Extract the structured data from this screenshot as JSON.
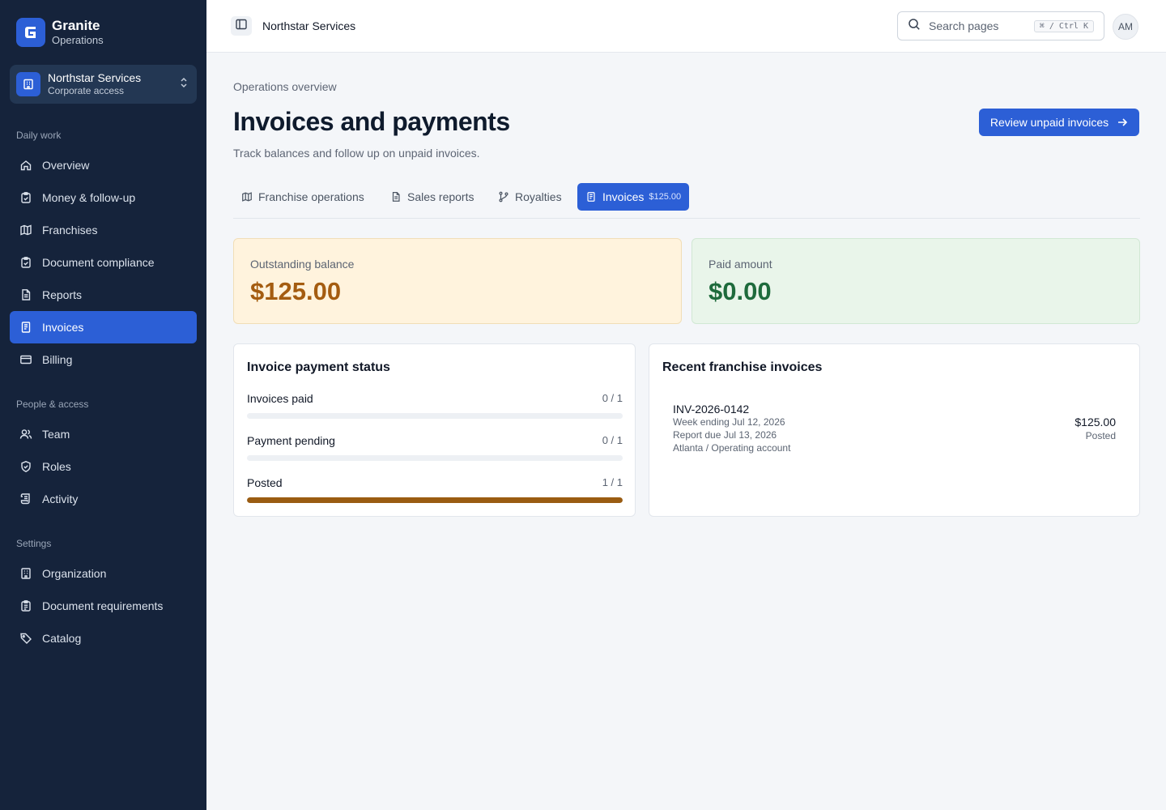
{
  "brand": {
    "name": "Granite",
    "sub": "Operations"
  },
  "org": {
    "name": "Northstar Services",
    "sub": "Corporate access"
  },
  "sidebar": {
    "sections": [
      {
        "label": "Daily work",
        "items": [
          {
            "label": "Overview",
            "icon": "home-icon"
          },
          {
            "label": "Money & follow-up",
            "icon": "clipboard-check-icon"
          },
          {
            "label": "Franchises",
            "icon": "map-icon"
          },
          {
            "label": "Document compliance",
            "icon": "clipboard-check-icon"
          },
          {
            "label": "Reports",
            "icon": "file-text-icon"
          },
          {
            "label": "Invoices",
            "icon": "invoice-icon",
            "active": true
          },
          {
            "label": "Billing",
            "icon": "credit-card-icon"
          }
        ]
      },
      {
        "label": "People & access",
        "items": [
          {
            "label": "Team",
            "icon": "users-icon"
          },
          {
            "label": "Roles",
            "icon": "shield-icon"
          },
          {
            "label": "Activity",
            "icon": "scroll-icon"
          }
        ]
      },
      {
        "label": "Settings",
        "items": [
          {
            "label": "Organization",
            "icon": "building-icon"
          },
          {
            "label": "Document requirements",
            "icon": "clipboard-list-icon"
          },
          {
            "label": "Catalog",
            "icon": "tag-icon"
          }
        ]
      }
    ]
  },
  "topbar": {
    "title": "Northstar Services",
    "search_placeholder": "Search pages",
    "shortcut": "⌘ / Ctrl K",
    "avatar": "AM"
  },
  "main": {
    "breadcrumb": "Operations overview",
    "title": "Invoices and payments",
    "subtitle": "Track balances and follow up on unpaid invoices.",
    "cta": "Review unpaid invoices",
    "tabs": [
      {
        "label": "Franchise operations",
        "icon": "map-icon"
      },
      {
        "label": "Sales reports",
        "icon": "file-text-icon"
      },
      {
        "label": "Royalties",
        "icon": "git-branch-icon"
      },
      {
        "label": "Invoices",
        "icon": "invoice-icon",
        "badge": "$125.00",
        "active": true
      }
    ],
    "stats": {
      "outstanding": {
        "label": "Outstanding balance",
        "value": "$125.00"
      },
      "paid": {
        "label": "Paid amount",
        "value": "$0.00"
      }
    },
    "status_card": {
      "title": "Invoice payment status",
      "rows": [
        {
          "label": "Invoices paid",
          "count": "0 / 1",
          "fraction": 0
        },
        {
          "label": "Payment pending",
          "count": "0 / 1",
          "fraction": 0
        },
        {
          "label": "Posted",
          "count": "1 / 1",
          "fraction": 1
        }
      ]
    },
    "recent_card": {
      "title": "Recent franchise invoices",
      "invoices": [
        {
          "id": "INV-2026-0142",
          "week": "Week ending Jul 12, 2026",
          "due": "Report due Jul 13, 2026",
          "account": "Atlanta / Operating account",
          "amount": "$125.00",
          "status": "Posted"
        }
      ]
    }
  },
  "colors": {
    "accent": "#2c5fd6",
    "sidebar": "#15233b",
    "warn_bg": "#fff3dd",
    "ok_bg": "#e9f5ea",
    "bar_fill": "#9a5c12"
  }
}
